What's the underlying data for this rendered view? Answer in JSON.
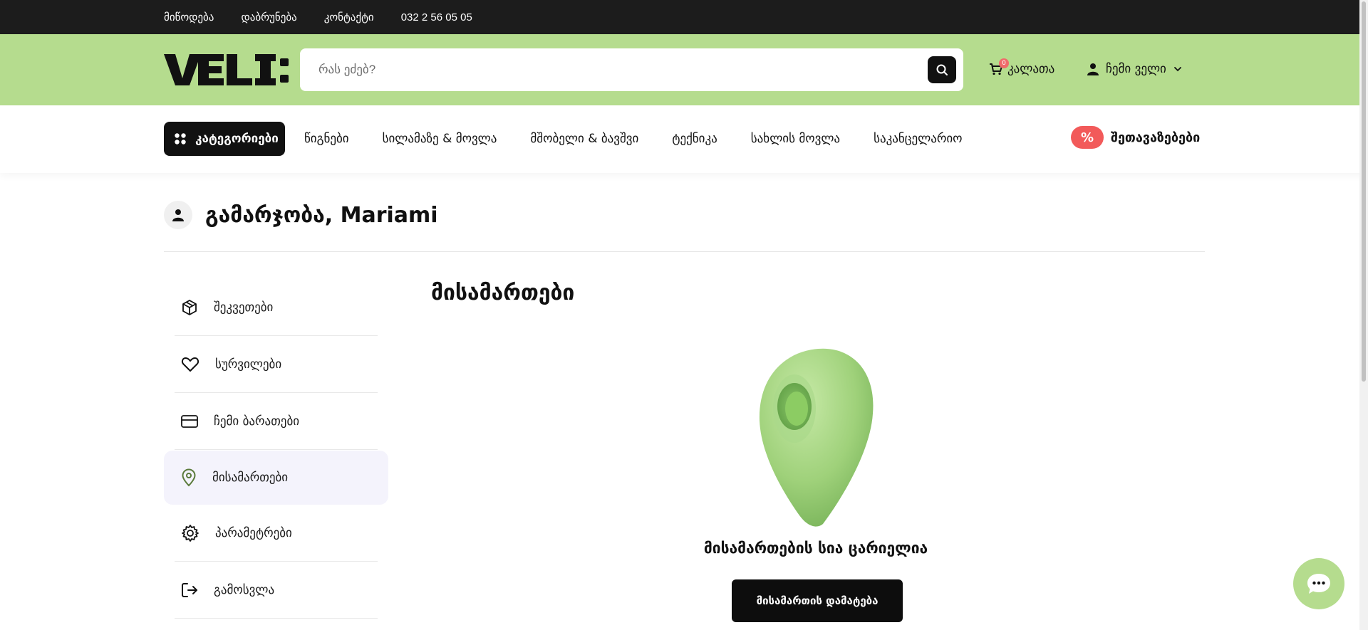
{
  "topbar": {
    "links": [
      "მიწოდება",
      "დაბრუნება",
      "კონტაქტი",
      "032 2 56 05 05"
    ]
  },
  "header": {
    "logo_text": "VELI:",
    "search_placeholder": "რას ეძებ?",
    "cart_count": "0",
    "cart_label": "კალათა",
    "account_label": "ჩემი ველი"
  },
  "nav": {
    "categories_label": "კატეგორიები",
    "links": [
      "წიგნები",
      "სილამაზე & მოვლა",
      "მშობელი & ბავშვი",
      "ტექნიკა",
      "სახლის მოვლა",
      "საკანცელარიო"
    ],
    "promo_badge": "%",
    "promo_label": "შეთავაზებები"
  },
  "greeting": "გამარჯობა, Mariami",
  "sidebar": {
    "items": [
      {
        "label": "შეკვეთები",
        "icon": "box-icon",
        "active": false
      },
      {
        "label": "სურვილები",
        "icon": "heart-icon",
        "active": false
      },
      {
        "label": "ჩემი ბარათები",
        "icon": "credit-card-icon",
        "active": false
      },
      {
        "label": "მისამართები",
        "icon": "map-pin-icon",
        "active": true
      },
      {
        "label": "პარამეტრები",
        "icon": "gear-icon",
        "active": false
      },
      {
        "label": "გამოსვლა",
        "icon": "logout-icon",
        "active": false
      }
    ]
  },
  "main": {
    "title": "მისამართები",
    "empty_message": "მისამართების სია ცარიელია",
    "add_button": "მისამართის დამატება"
  },
  "colors": {
    "brand_green": "#b5dc8e",
    "dark": "#1c1c1c",
    "promo_red": "#f25a5a",
    "active_bg": "#f4f3fc"
  }
}
